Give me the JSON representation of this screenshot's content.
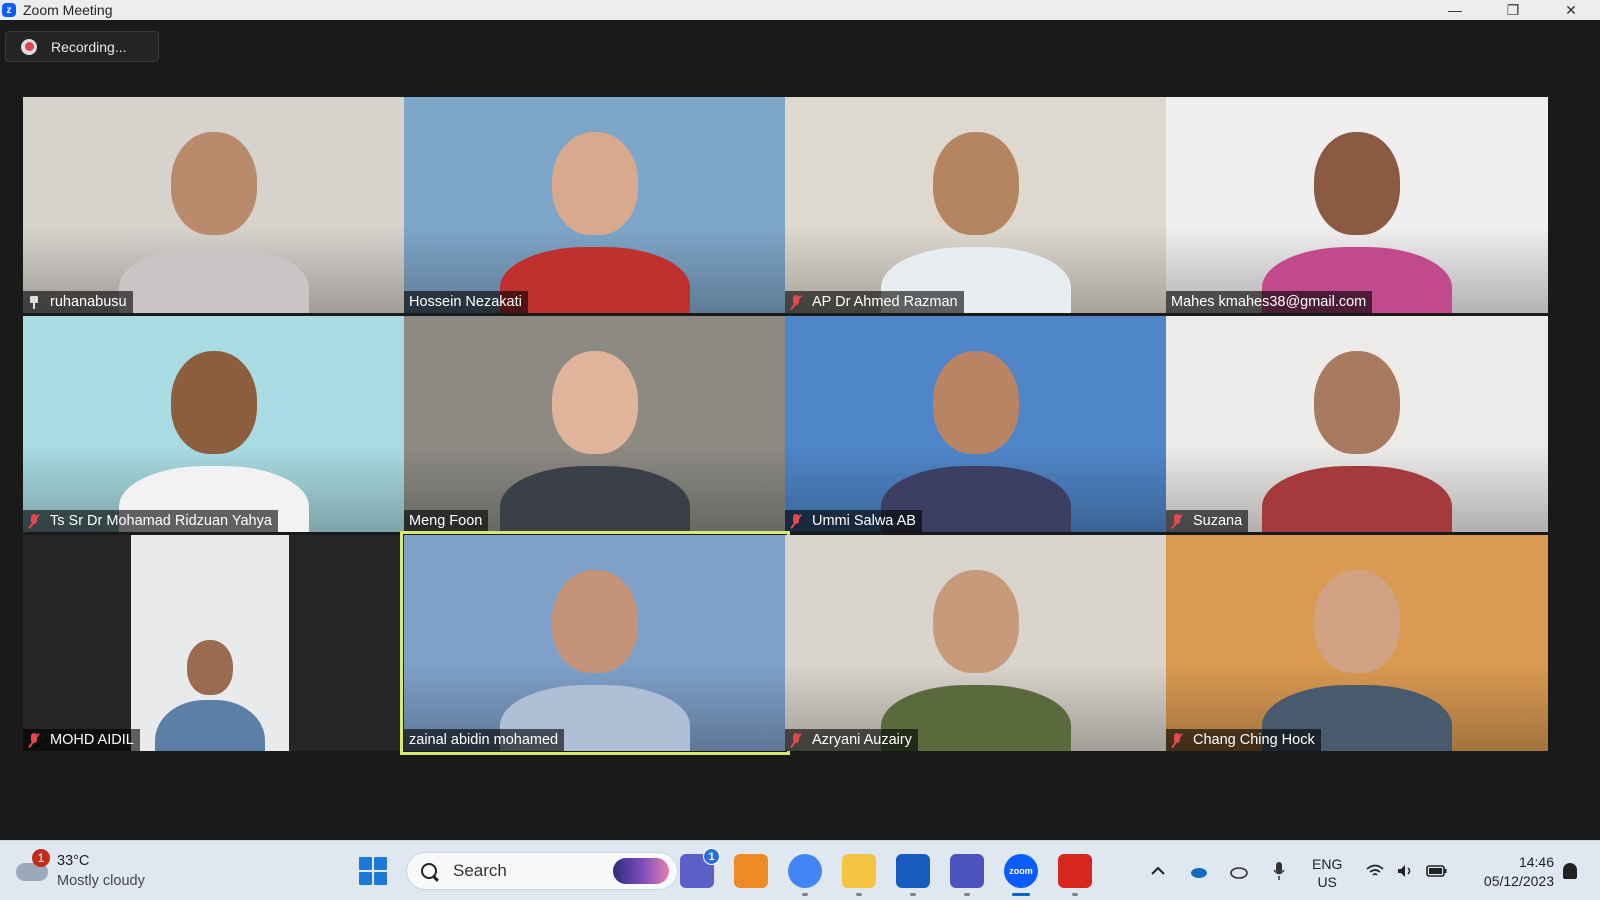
{
  "window": {
    "app_icon": "zoom-logo",
    "title": "Zoom Meeting",
    "controls": [
      "minimize",
      "restore",
      "close"
    ]
  },
  "meeting": {
    "recording_label": "Recording...",
    "participants": [
      {
        "name": "ruhanabusu",
        "muted": false,
        "pinned": true,
        "active_speaker": false,
        "bg": "#d6d2cc",
        "skin": "#b98a6b",
        "cloth": "#c9c4c6"
      },
      {
        "name": "Hossein Nezakati",
        "muted": false,
        "pinned": false,
        "active_speaker": false,
        "bg": "#7ea6c8",
        "skin": "#d9a98e",
        "cloth": "#c0302e"
      },
      {
        "name": "AP Dr Ahmed Razman",
        "muted": true,
        "pinned": false,
        "active_speaker": false,
        "bg": "#ddd9cf",
        "skin": "#b5855f",
        "cloth": "#e8edf2"
      },
      {
        "name": "Mahes kmahes38@gmail.com",
        "muted": false,
        "pinned": false,
        "active_speaker": false,
        "bg": "#f0eef0",
        "skin": "#8a5a43",
        "cloth": "#c04a8c"
      },
      {
        "name": "Ts Sr Dr Mohamad Ridzuan Yahya",
        "muted": true,
        "pinned": false,
        "active_speaker": false,
        "bg": "#a9dbe3",
        "skin": "#8c5d3f",
        "cloth": "#f2f2f2"
      },
      {
        "name": "Meng Foon",
        "muted": false,
        "pinned": false,
        "active_speaker": false,
        "bg": "#8c8a83",
        "skin": "#e0b49a",
        "cloth": "#3b4048"
      },
      {
        "name": "Ummi Salwa AB",
        "muted": true,
        "pinned": false,
        "active_speaker": false,
        "bg": "#4f86c9",
        "skin": "#b98464",
        "cloth": "#3c3f63"
      },
      {
        "name": "Suzana",
        "muted": true,
        "pinned": false,
        "active_speaker": false,
        "bg": "#ecebea",
        "skin": "#a87a60",
        "cloth": "#a43a3c"
      },
      {
        "name": "MOHD AIDIL",
        "muted": true,
        "pinned": false,
        "active_speaker": false,
        "bg": "#2b2b2b",
        "skin": "#9a6b4e",
        "cloth": "#5c7fa8"
      },
      {
        "name": "zainal abidin mohamed",
        "muted": false,
        "pinned": false,
        "active_speaker": true,
        "bg": "#7ea0c9",
        "skin": "#c59478",
        "cloth": "#aebfd6"
      },
      {
        "name": "Azryani Auzairy",
        "muted": true,
        "pinned": false,
        "active_speaker": false,
        "bg": "#d8d4cc",
        "skin": "#c79a7c",
        "cloth": "#5b6a3c"
      },
      {
        "name": "Chang Ching Hock",
        "muted": true,
        "pinned": false,
        "active_speaker": false,
        "bg": "#d99a52",
        "skin": "#d0a283",
        "cloth": "#4a5a6e"
      }
    ]
  },
  "taskbar": {
    "weather": {
      "badge": "1",
      "temp": "33°C",
      "condition": "Mostly cloudy"
    },
    "search_placeholder": "Search",
    "apps": [
      {
        "name": "teams-chat",
        "badge": "1",
        "color": "#5b5fc7"
      },
      {
        "name": "search-tool",
        "color": "#f08a24"
      },
      {
        "name": "chrome",
        "color": "#4285f4"
      },
      {
        "name": "file-explorer",
        "color": "#f5c542"
      },
      {
        "name": "word",
        "color": "#185abd"
      },
      {
        "name": "teams",
        "color": "#4b53bc"
      },
      {
        "name": "zoom",
        "color": "#0b5cff",
        "label": "zoom"
      },
      {
        "name": "acrobat",
        "color": "#d7261e"
      }
    ],
    "language_line1": "ENG",
    "language_line2": "US",
    "time": "14:46",
    "date": "05/12/2023"
  }
}
